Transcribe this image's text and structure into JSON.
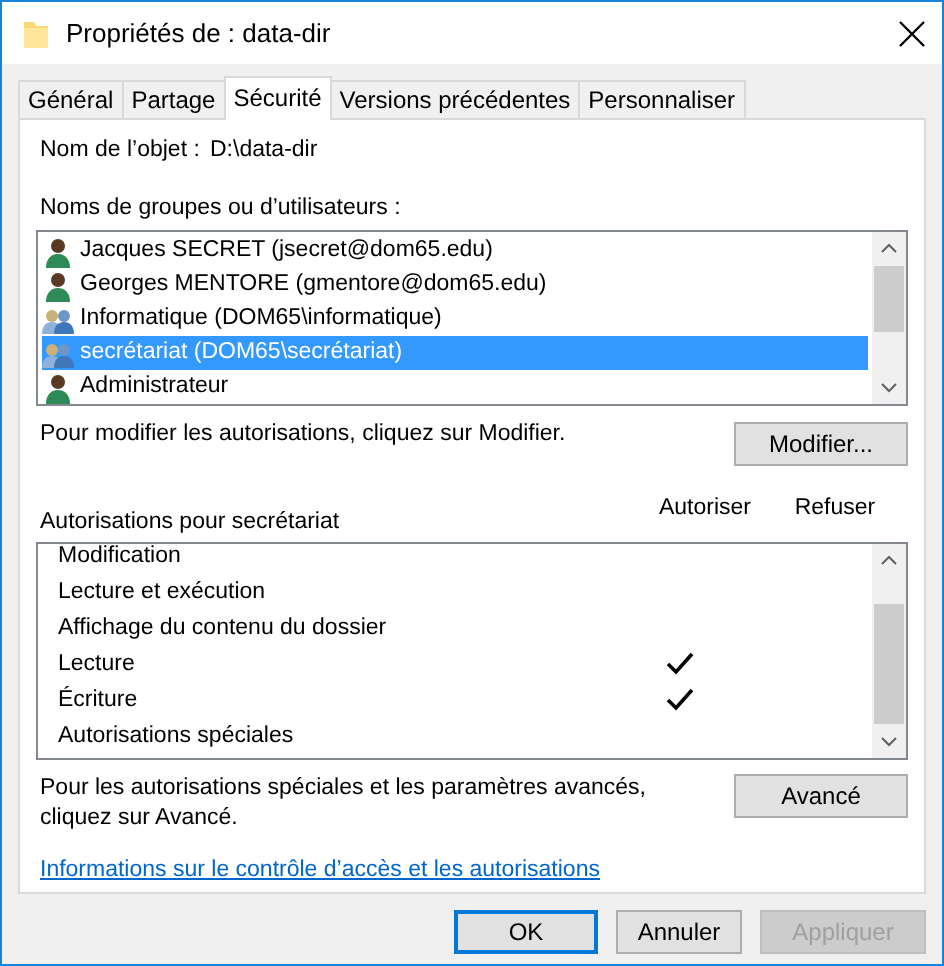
{
  "window": {
    "title": "Propriétés de : data-dir"
  },
  "tabs": [
    {
      "label": "Général",
      "selected": false
    },
    {
      "label": "Partage",
      "selected": false
    },
    {
      "label": "Sécurité",
      "selected": true
    },
    {
      "label": "Versions précédentes",
      "selected": false
    },
    {
      "label": "Personnaliser",
      "selected": false
    }
  ],
  "object_name": {
    "label": "Nom de l’objet :",
    "value": "D:\\data-dir"
  },
  "principals": {
    "label": "Noms de groupes ou d’utilisateurs :",
    "items": [
      {
        "name": "Jacques SECRET (jsecret@dom65.edu)",
        "kind": "user",
        "selected": false
      },
      {
        "name": "Georges MENTORE (gmentore@dom65.edu)",
        "kind": "user",
        "selected": false
      },
      {
        "name": "Informatique (DOM65\\informatique)",
        "kind": "group",
        "selected": false
      },
      {
        "name": "secrétariat (DOM65\\secrétariat)",
        "kind": "group",
        "selected": true
      },
      {
        "name": "Administrateur",
        "kind": "user",
        "selected": false
      }
    ]
  },
  "modify_hint": "Pour modifier les autorisations, cliquez sur Modifier.",
  "modify_button": "Modifier...",
  "permissions": {
    "label": "Autorisations pour secrétariat",
    "columns": [
      "Autoriser",
      "Refuser"
    ],
    "rows": [
      {
        "label": "Modification",
        "allow": false,
        "deny": false
      },
      {
        "label": "Lecture et exécution",
        "allow": false,
        "deny": false
      },
      {
        "label": "Affichage du contenu du dossier",
        "allow": false,
        "deny": false
      },
      {
        "label": "Lecture",
        "allow": true,
        "deny": false
      },
      {
        "label": "Écriture",
        "allow": true,
        "deny": false
      },
      {
        "label": "Autorisations spéciales",
        "allow": false,
        "deny": false
      }
    ]
  },
  "advanced_hint": "Pour les autorisations spéciales et les paramètres avancés, cliquez sur Avancé.",
  "advanced_button": "Avancé",
  "help_link": "Informations sur le contrôle d’accès et les autorisations",
  "buttons": [
    {
      "label": "OK",
      "default": true,
      "disabled": false
    },
    {
      "label": "Annuler",
      "default": false,
      "disabled": false
    },
    {
      "label": "Appliquer",
      "default": false,
      "disabled": true
    }
  ]
}
